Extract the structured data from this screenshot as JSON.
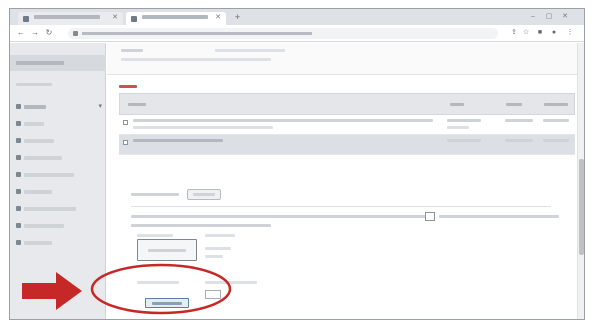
{
  "browser": {
    "tabs": [
      {
        "title": "",
        "active": false
      },
      {
        "title": "",
        "active": true
      }
    ],
    "address_url": ""
  },
  "sidebar": {
    "header": "",
    "section_label": "",
    "items": [
      {
        "label": "",
        "icon": "list-icon",
        "expandable": true
      },
      {
        "label": "",
        "icon": "list-icon"
      },
      {
        "label": "",
        "icon": "list-icon"
      },
      {
        "label": "",
        "icon": "list-icon"
      },
      {
        "label": "",
        "icon": "list-icon"
      },
      {
        "label": "",
        "icon": "list-icon"
      },
      {
        "label": "",
        "icon": "list-icon"
      },
      {
        "label": "",
        "icon": "list-icon"
      },
      {
        "label": "",
        "icon": "list-icon"
      }
    ]
  },
  "main": {
    "table": {
      "title": "",
      "columns": [
        "",
        "",
        "",
        ""
      ],
      "rows": [
        {
          "cells": [
            "",
            "",
            "",
            ""
          ],
          "selected": false
        },
        {
          "cells": [
            "",
            "",
            "",
            ""
          ],
          "selected": true
        }
      ]
    },
    "form": {
      "section_label": "",
      "section_button": "",
      "description": "",
      "upload_1": {
        "label": "",
        "button": "",
        "status": ""
      },
      "upload_2": {
        "label": "",
        "button": "",
        "status": ""
      }
    }
  },
  "overlay": {
    "arrow_color": "#c62828",
    "highlight_color": "#c62828"
  }
}
